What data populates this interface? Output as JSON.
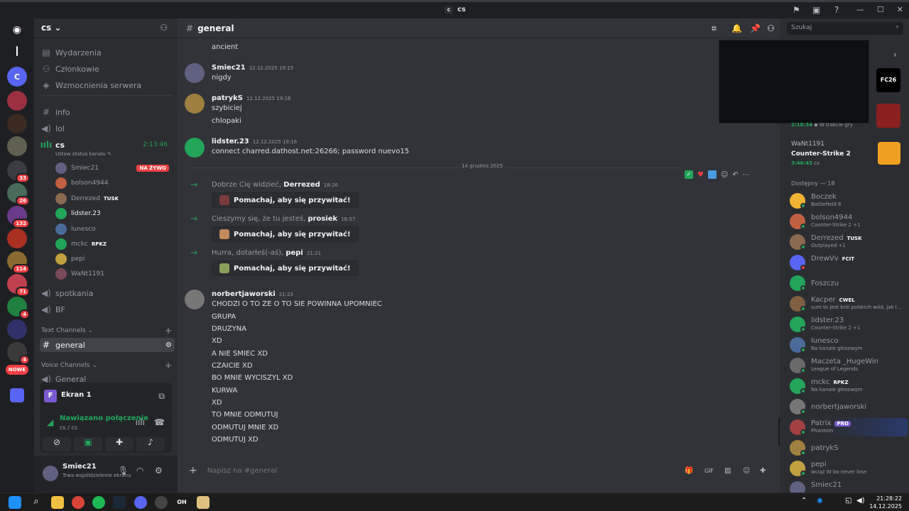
{
  "window": {
    "title": "cs",
    "title_badge": "c"
  },
  "server": {
    "name": "cs"
  },
  "nav": {
    "events": "Wydarzenia",
    "members": "Członkowie",
    "boosts": "Wzmocnienia serwera"
  },
  "channels": {
    "info": "info",
    "lol": "lol",
    "cs": "cs",
    "cs_timer": "2:13:46",
    "cs_status": "Ustaw status kanału",
    "spotkania": "spotkania",
    "bf": "BF",
    "text_category": "Text Channels",
    "general": "general",
    "voice_category": "Voice Channels",
    "general_voice": "General"
  },
  "voice_users": [
    {
      "name": "Smiec21",
      "badge": "NA ŻYWO"
    },
    {
      "name": "bolson4944",
      "badge": ""
    },
    {
      "name": "Derrezed",
      "badge": "TUSK"
    },
    {
      "name": "lidster.23",
      "badge": ""
    },
    {
      "name": "lunesco",
      "badge": ""
    },
    {
      "name": "mckc",
      "badge": "RPKZ"
    },
    {
      "name": "pepi",
      "badge": ""
    },
    {
      "name": "WaNt1191",
      "badge": ""
    }
  ],
  "server_badges": [
    "33",
    "26",
    "132",
    "114",
    "71",
    "4",
    "4",
    "NOWE"
  ],
  "screen_share": {
    "label": "Ekran 1",
    "initial": "F"
  },
  "voice_panel": {
    "status": "Nawiązano połączenie",
    "location": "cs / cs"
  },
  "user": {
    "name": "Smiec21",
    "status": "Trwa współdzielenie ekranu"
  },
  "chat": {
    "channel": "general",
    "messages": [
      {
        "author": "",
        "time": "",
        "lines": [
          "ancient"
        ]
      },
      {
        "author": "Smiec21",
        "time": "12.12.2025 19:15",
        "lines": [
          "nigdy"
        ]
      },
      {
        "author": "patrykS",
        "time": "12.12.2025 19:16",
        "lines": [
          "szybiciej",
          "chlopaki"
        ]
      },
      {
        "author": "lidster.23",
        "time": "12.12.2025 19:16",
        "lines": [
          "connect charred.dathost.net:26266; password nuevo15"
        ]
      }
    ],
    "date_divider": "14 grudnia 2025",
    "system": [
      {
        "text": "Dobrze Cię widzieć, ",
        "user": "Derrezed",
        "time": "18:26",
        "wave": "Pomachaj, aby się przywitać!"
      },
      {
        "text": "Cieszymy się, że tu jesteś, ",
        "user": "prosiek",
        "time": "18:57",
        "wave": "Pomachaj, aby się przywitać!"
      },
      {
        "text": "Hurra, dotarłeś(-aś), ",
        "user": "pepi",
        "time": "21:21",
        "wave": "Pomachaj, aby się przywitać!"
      }
    ],
    "last_message": {
      "author": "norbertjaworski",
      "time": "21:23",
      "lines": [
        "CHODZI O TO ZE O TO SIE POWINNA UPOMNIEC",
        "GRUPA",
        "DRUZYNA",
        "XD",
        "A NIE SMIEC XD",
        "CZAICIE XD",
        "BO MNIE WYCISZYL XD",
        "KURWA",
        "XD",
        "TO MNIE ODMUTUJ",
        "ODMUTUJ MNIE XD",
        "ODMUTUJ XD"
      ]
    },
    "input_placeholder": "Napisz na #general"
  },
  "search": {
    "placeholder": "Szukaj"
  },
  "members": {
    "playing_top": {
      "timer": "2:18:34",
      "status": "W trakcie gry"
    },
    "want": {
      "name": "WaNt1191",
      "game": "Counter-Strike 2",
      "timer": "3:46:45",
      "where": "cs"
    },
    "available_header": "Dostępny — 18",
    "list": [
      {
        "name": "Boczek",
        "tag": "",
        "status": "Battlefield 6",
        "color": "#f0b232"
      },
      {
        "name": "bolson4944",
        "tag": "",
        "status": "Counter-Strike 2 +1",
        "color": "#c06040"
      },
      {
        "name": "Derrezed",
        "tag": "TUSK",
        "status": "Outplayed +1",
        "color": "#8a6a50"
      },
      {
        "name": "DrewVv",
        "tag": "FCIT",
        "status": "",
        "color": "#5865f2"
      },
      {
        "name": "Foszczu",
        "tag": "",
        "status": "",
        "color": "#23a55a"
      },
      {
        "name": "Kacper",
        "tag": "CWEL",
        "status": "sum to jest król polskich wód, jak l...",
        "color": "#806040"
      },
      {
        "name": "lidster.23",
        "tag": "",
        "status": "Counter-Strike 2 +1",
        "color": "#23a55a"
      },
      {
        "name": "lunesco",
        "tag": "",
        "status": "Na kanale głosowym",
        "color": "#4a6a9a"
      },
      {
        "name": "Maczeta _HugeWin",
        "tag": "",
        "status": "League of Legends",
        "color": "#6a6a6a"
      },
      {
        "name": "mckc",
        "tag": "RPKZ",
        "status": "Na kanale głosowym",
        "color": "#23a55a"
      },
      {
        "name": "norbertjaworski",
        "tag": "",
        "status": "",
        "color": "#777"
      },
      {
        "name": "Patrix",
        "tag": "PRO",
        "status": "Phantom",
        "color": "#a04040"
      },
      {
        "name": "patrykS",
        "tag": "",
        "status": "",
        "color": "#a08040"
      },
      {
        "name": "pepi",
        "tag": "",
        "status": "wciąż W bo never lose",
        "color": "#c0a040"
      },
      {
        "name": "Smiec21",
        "tag": "",
        "status": "",
        "color": "#606080"
      }
    ]
  },
  "taskbar": {
    "time": "21:28:22",
    "date": "14.12.2025"
  }
}
